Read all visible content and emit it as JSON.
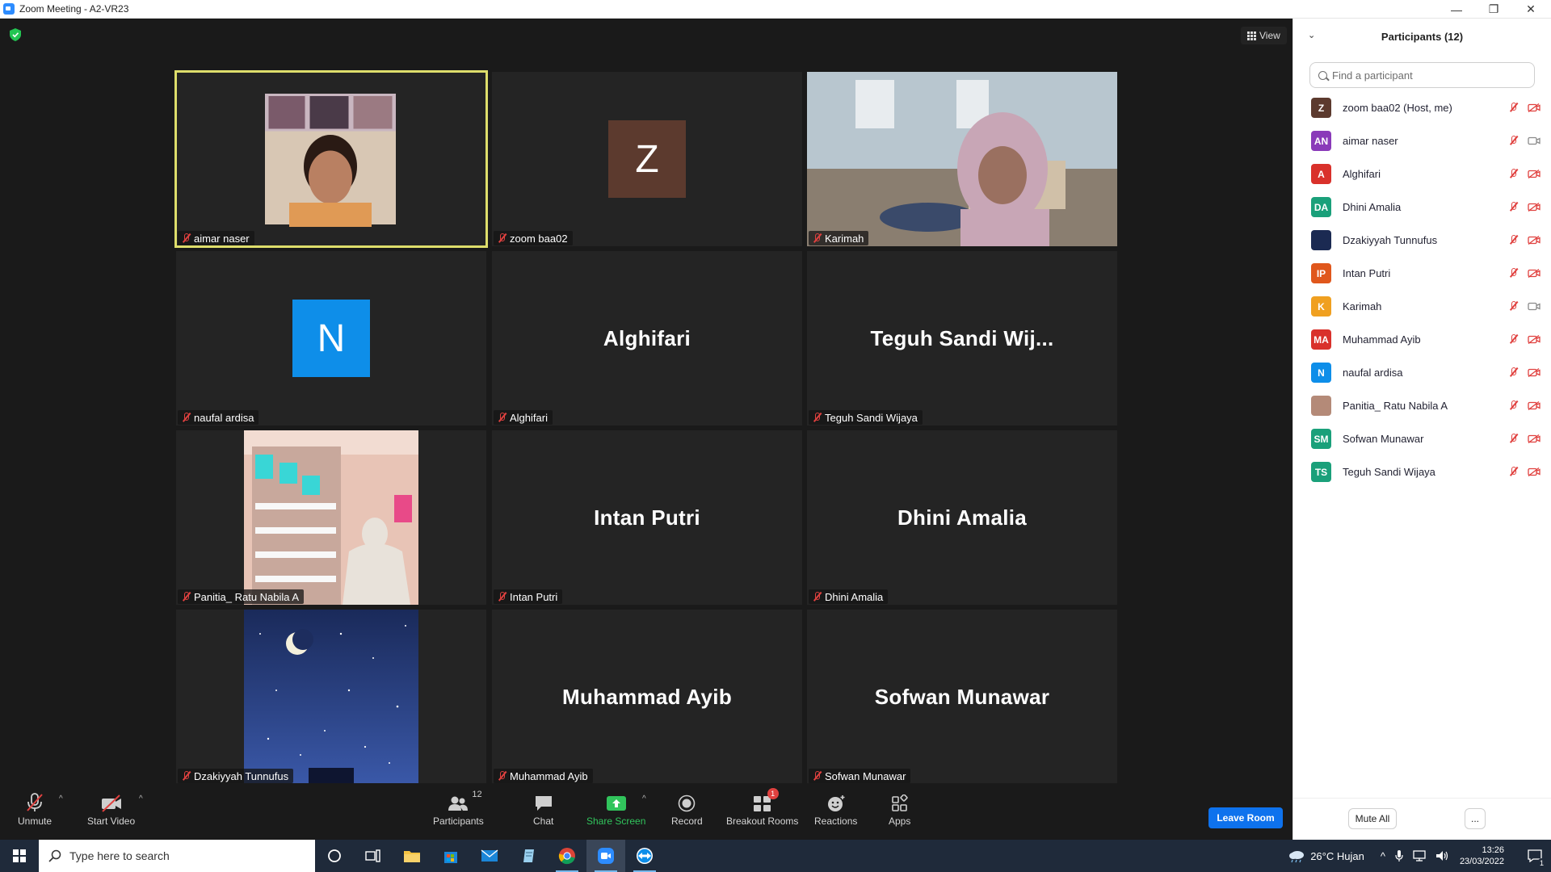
{
  "window": {
    "title": "Zoom Meeting - A2-VR23",
    "minimize_glyph": "—",
    "restore_glyph": "❐",
    "close_glyph": "✕"
  },
  "view_button": {
    "label": "View"
  },
  "tiles": [
    {
      "name": "aimar naser",
      "display": "video",
      "active": true
    },
    {
      "name": "zoom baa02",
      "display": "avatar",
      "initial": "Z",
      "color": "#5c3a2e"
    },
    {
      "name": "Karimah",
      "display": "video"
    },
    {
      "name": "naufal ardisa",
      "display": "avatar",
      "initial": "N",
      "color": "#0e8ee9"
    },
    {
      "name": "Alghifari",
      "display": "name",
      "big_name": "Alghifari"
    },
    {
      "name": "Teguh Sandi Wijaya",
      "display": "name",
      "big_name": "Teguh Sandi Wij..."
    },
    {
      "name": "Panitia_ Ratu Nabila A",
      "display": "video"
    },
    {
      "name": "Intan Putri",
      "display": "name",
      "big_name": "Intan Putri"
    },
    {
      "name": "Dhini Amalia",
      "display": "name",
      "big_name": "Dhini Amalia"
    },
    {
      "name": "Dzakiyyah Tunnufus",
      "display": "video"
    },
    {
      "name": "Muhammad Ayib",
      "display": "name",
      "big_name": "Muhammad Ayib"
    },
    {
      "name": "Sofwan Munawar",
      "display": "name",
      "big_name": "Sofwan Munawar"
    }
  ],
  "toolbar": {
    "unmute": "Unmute",
    "start_video": "Start Video",
    "participants": "Participants",
    "participants_count": "12",
    "chat": "Chat",
    "share_screen": "Share Screen",
    "record": "Record",
    "breakout_rooms": "Breakout Rooms",
    "breakout_badge": "1",
    "reactions": "Reactions",
    "apps": "Apps",
    "leave_room": "Leave Room",
    "caret_glyph": "^"
  },
  "panel": {
    "title": "Participants (12)",
    "collapse_glyph": "⌄",
    "search_placeholder": "Find a participant",
    "mute_all": "Mute All",
    "more": "...",
    "participants": [
      {
        "initials": "Z",
        "name": "zoom baa02 (Host, me)",
        "color": "#5c3a2e",
        "video": "off"
      },
      {
        "initials": "AN",
        "name": "aimar naser",
        "color": "#8a3ab9",
        "video": "on"
      },
      {
        "initials": "A",
        "name": "Alghifari",
        "color": "#d9312b",
        "video": "off"
      },
      {
        "initials": "DA",
        "name": "Dhini Amalia",
        "color": "#1aa07a",
        "video": "off"
      },
      {
        "initials": "",
        "name": "Dzakiyyah Tunnufus",
        "color": "#1b2a52",
        "video": "off"
      },
      {
        "initials": "IP",
        "name": "Intan Putri",
        "color": "#e0571c",
        "video": "off"
      },
      {
        "initials": "K",
        "name": "Karimah",
        "color": "#f0a020",
        "video": "on"
      },
      {
        "initials": "MA",
        "name": "Muhammad Ayib",
        "color": "#d9312b",
        "video": "off"
      },
      {
        "initials": "N",
        "name": "naufal ardisa",
        "color": "#0e8ee9",
        "video": "off"
      },
      {
        "initials": "",
        "name": "Panitia_ Ratu Nabila A",
        "color": "#b48a78",
        "video": "off"
      },
      {
        "initials": "SM",
        "name": "Sofwan Munawar",
        "color": "#1aa07a",
        "video": "off"
      },
      {
        "initials": "TS",
        "name": "Teguh Sandi Wijaya",
        "color": "#1aa07a",
        "video": "off"
      }
    ]
  },
  "taskbar": {
    "search_placeholder": "Type here to search",
    "weather": "26°C Hujan",
    "time": "13:26",
    "date": "23/03/2022",
    "notifications": "1",
    "tray_glyph": "^"
  },
  "colors": {
    "accent": "#0e72ed",
    "active_speaker": "#dede6b",
    "share_green": "#31c45c",
    "muted_red": "#e0413f"
  }
}
